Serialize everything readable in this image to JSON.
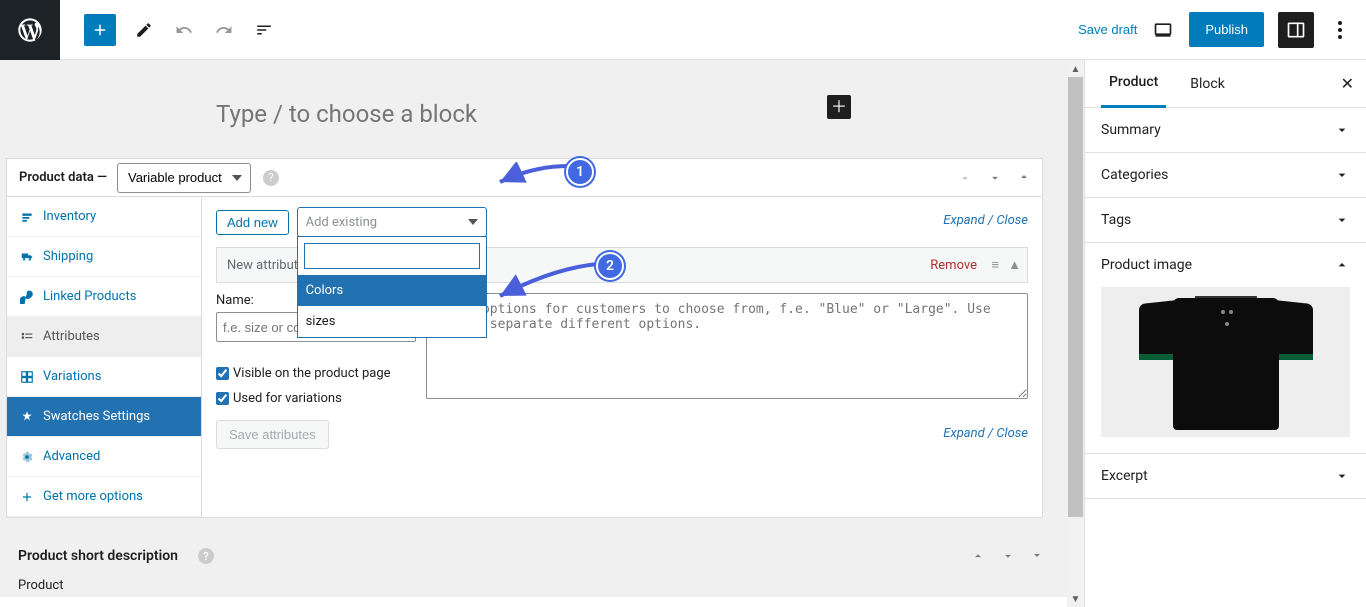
{
  "topbar": {
    "save_draft": "Save draft",
    "publish": "Publish"
  },
  "editor": {
    "block_placeholder": "Type / to choose a block"
  },
  "product_data": {
    "title": "Product data —",
    "type_selected": "Variable product",
    "tabs": {
      "inventory": "Inventory",
      "shipping": "Shipping",
      "linked": "Linked Products",
      "attributes": "Attributes",
      "variations": "Variations",
      "swatches": "Swatches Settings",
      "advanced": "Advanced",
      "more": "Get more options"
    },
    "attr_panel": {
      "add_new": "Add new",
      "add_existing_placeholder": "Add existing",
      "dropdown_options": {
        "colors": "Colors",
        "sizes": "sizes"
      },
      "expand_collapse": "Expand / Close",
      "new_attribute": "New attribute",
      "remove": "Remove",
      "name_label": "Name:",
      "name_placeholder": "f.e. size or color",
      "values_placeholder": "Enter options for customers to choose from, f.e. \"Blue\" or \"Large\". Use \"|\" to separate different options.",
      "visible_label": "Visible on the product page",
      "used_for_variations": "Used for variations",
      "save_attributes": "Save attributes"
    }
  },
  "short_desc": {
    "title": "Product short description",
    "footer": "Product"
  },
  "sidebar": {
    "tabs": {
      "product": "Product",
      "block": "Block"
    },
    "panels": {
      "summary": "Summary",
      "categories": "Categories",
      "tags": "Tags",
      "product_image": "Product image",
      "excerpt": "Excerpt"
    }
  },
  "callouts": {
    "one": "1",
    "two": "2"
  }
}
